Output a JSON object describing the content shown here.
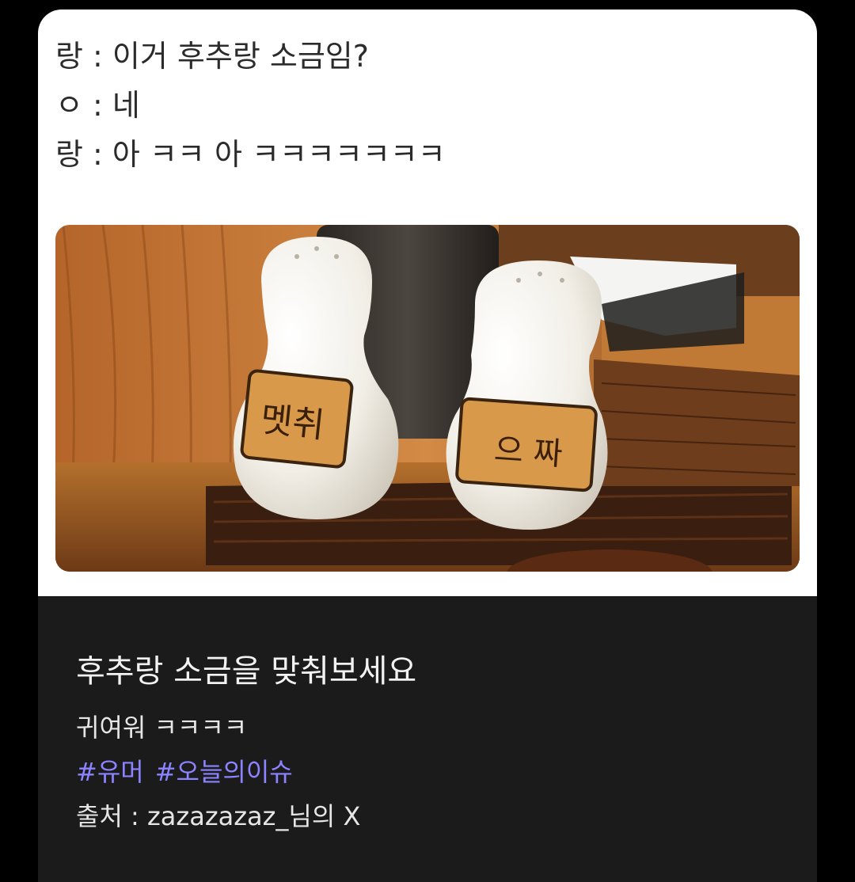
{
  "chat": {
    "lines": [
      "랑 : 이거 후추랑 소금임?",
      "ㅇ : 네",
      "랑 : 아 ㅋㅋ 아 ㅋㅋㅋㅋㅋㅋㅋ"
    ]
  },
  "photo": {
    "left_label": "멧취",
    "right_label": "으 짜"
  },
  "post": {
    "title": "후추랑 소금을 맞춰보세요",
    "body": "귀여워 ㅋㅋㅋㅋ",
    "hashtags": [
      "#유머",
      "#오늘의이슈"
    ],
    "source": "출처 : zazazazaz_님의 X"
  },
  "colors": {
    "background": "#000000",
    "card_dark": "#1b1b1b",
    "hashtag": "#8b83ff"
  }
}
